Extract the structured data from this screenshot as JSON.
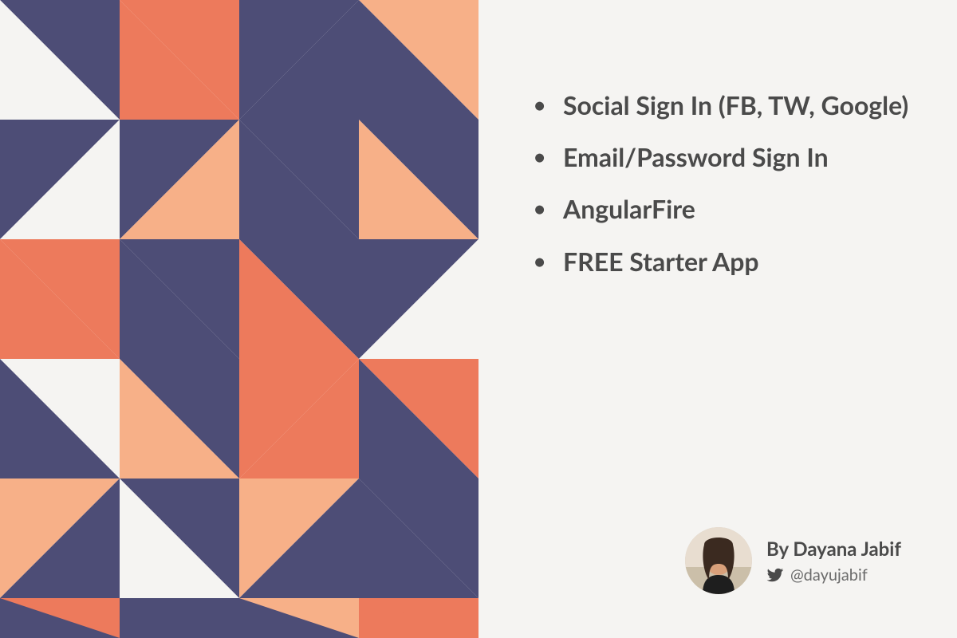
{
  "bullets": {
    "items": [
      "Social Sign In (FB, TW, Google)",
      "Email/Password Sign In",
      "AngularFire",
      "FREE Starter App"
    ]
  },
  "author": {
    "byline": "By Dayana Jabif",
    "handle": "@dayujabif"
  },
  "colors": {
    "navy": "#4d4d76",
    "coral": "#ed7a5c",
    "peach": "#f7b088",
    "cream": "#f5f4f2",
    "text": "#4a4a4a"
  }
}
